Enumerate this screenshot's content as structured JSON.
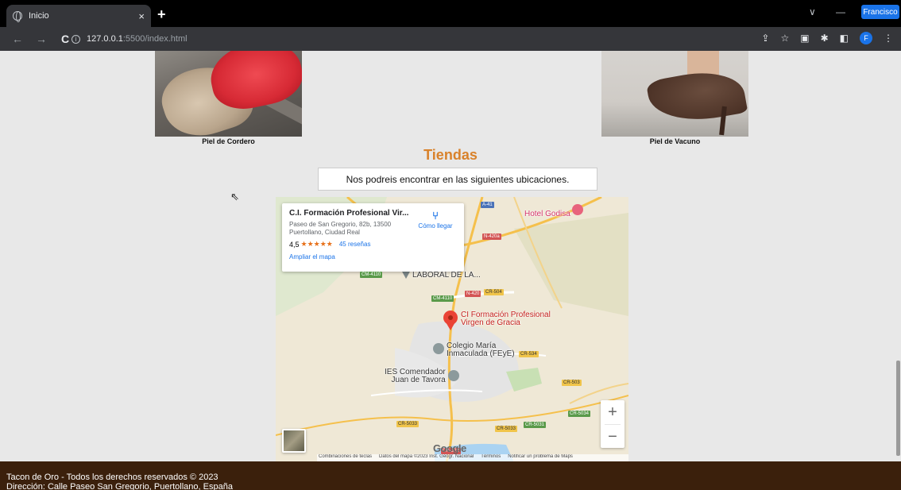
{
  "browser": {
    "tab_title": "Inicio",
    "tab_close": "×",
    "new_tab": "+",
    "profile_name": "Francisco",
    "profile_initial": "F",
    "url_host": "127.0.0.1",
    "url_port_path": ":5500/index.html",
    "nav": {
      "back": "←",
      "forward": "→",
      "reload": "C"
    },
    "window_controls": {
      "collapse": "∨",
      "minimize": "—"
    }
  },
  "products": [
    {
      "caption": "Piel de Cordero",
      "image": "beige-and-red-loafers-photo"
    },
    {
      "caption": "Piel de Vacuno",
      "image": "brown-kitten-heel-photo"
    }
  ],
  "stores": {
    "title": "Tiendas",
    "intro": "Nos podreis encontrar en las siguientes ubicaciones."
  },
  "map": {
    "card": {
      "name": "C.I. Formación Profesional Vir...",
      "address": "Paseo de San Gregorio, 82b, 13500 Puertollano, Ciudad Real",
      "rating": "4,5",
      "stars": "★★★★★",
      "reviews": "45 reseñas",
      "enlarge": "Ampliar el mapa",
      "directions": "Cómo llegar"
    },
    "labels": {
      "hotel": "Hotel Godisa",
      "laboral": "LABORAL DE LA...",
      "ci_line1": "CI Formación Profesional",
      "ci_line2": "Virgen de Gracia",
      "colegio_line1": "Colegio María",
      "colegio_line2": "Inmaculada (FEyE)",
      "ies_line1": "IES Comendador",
      "ies_line2": "Juan de Tavora"
    },
    "roads": {
      "a41": "A-41",
      "n420a": "N-420a",
      "cm4110a": "CM-4110",
      "cm4110b": "CM-4110",
      "n420": "N-420",
      "cr504": "CR-504",
      "cr534": "CR-534",
      "cr503": "CR-503",
      "cr5034": "CR-5034",
      "cr5033a": "CR-5033",
      "cr5033b": "CR-5033",
      "cr5031": "CR-5031",
      "cr502": "CR-502"
    },
    "zoom_in": "+",
    "zoom_out": "−",
    "google": "Google",
    "attribution": {
      "shortcuts": "Combinaciones de teclas",
      "data": "Datos del mapa ©2023 Inst. Geogr. Nacional",
      "terms": "Términos",
      "report": "Notificar un problema de Maps"
    }
  },
  "footer": {
    "line1": "Tacon de Oro - Todos los derechos reservados © 2023",
    "line2": "Dirección: Calle Paseo San Gregorio, Puertollano, España"
  },
  "colors": {
    "title_orange": "#d9822b",
    "footer_brown": "#3b200c",
    "link_blue": "#1a73e8",
    "pin_red": "#ea4335"
  }
}
